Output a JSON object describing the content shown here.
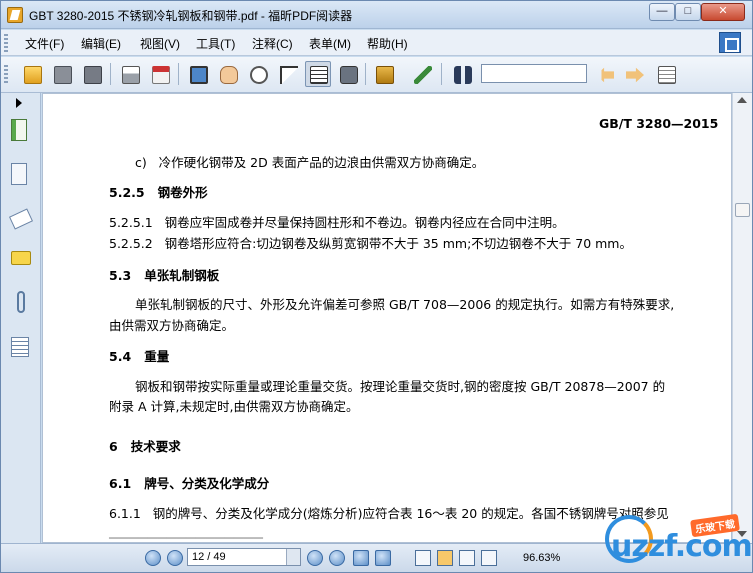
{
  "window": {
    "title": "GBT 3280-2015 不锈钢冷轧钢板和钢带.pdf - 福昕PDF阅读器",
    "min_label": "—",
    "max_label": "□",
    "close_label": "✕"
  },
  "menu": {
    "items": [
      "文件(F)",
      "编辑(E)",
      "视图(V)",
      "工具(T)",
      "注释(C)",
      "表单(M)",
      "帮助(H)"
    ]
  },
  "toolbar": {
    "search_value": "",
    "icons": [
      "open-folder-icon",
      "save-icon",
      "save-as-icon",
      "print-icon",
      "email-icon",
      "screen-icon",
      "hand-tool-icon",
      "zoom-glass-icon",
      "select-arrow-icon",
      "text-select-icon",
      "snapshot-camera-icon",
      "rms-lock-icon",
      "sign-pen-icon",
      "binoculars-icon",
      "find-prev-icon",
      "find-next-icon",
      "doc-dropdown-icon"
    ]
  },
  "document": {
    "header": "GB/T 3280—2015",
    "lines": [
      {
        "text": "c)   冷作硬化钢带及 2D 表面产品的边浪由供需双方协商确定。",
        "bold": false
      },
      {
        "text": "5.2.5   钢卷外形",
        "bold": true
      },
      {
        "text": "5.2.5.1   钢卷应牢固成卷并尽量保持圆柱形和不卷边。钢卷内径应在合同中注明。",
        "bold": false,
        "num_bold": true
      },
      {
        "text": "5.2.5.2   钢卷塔形应符合:切边钢卷及纵剪宽钢带不大于 35 mm;不切边钢卷不大于 70 mm。",
        "bold": false,
        "num_bold": true
      },
      {
        "text": "5.3   单张轧制钢板",
        "bold": true
      },
      {
        "text": "单张轧制钢板的尺寸、外形及允许偏差可参照 GB/T 708—2006 的规定执行。如需方有特殊要求,",
        "bold": false
      },
      {
        "text": "由供需双方协商确定。",
        "bold": false
      },
      {
        "text": "5.4   重量",
        "bold": true
      },
      {
        "text": "钢板和钢带按实际重量或理论重量交货。按理论重量交货时,钢的密度按 GB/T 20878—2007 的",
        "bold": false
      },
      {
        "text": "附录 A 计算,未规定时,由供需双方协商确定。",
        "bold": false
      },
      {
        "text": "6   技术要求",
        "bold": true
      },
      {
        "text": "6.1   牌号、分类及化学成分",
        "bold": true
      },
      {
        "text": "6.1.1   钢的牌号、分类及化学成分(熔炼分析)应符合表 16～表 20 的规定。各国不锈钢牌号对照参见",
        "bold": false,
        "num_bold": true
      }
    ]
  },
  "status": {
    "page": "12 / 49",
    "zoom": "96.63%"
  },
  "watermark": {
    "badge": "乐玻下载",
    "logo": "uzzf.com"
  }
}
